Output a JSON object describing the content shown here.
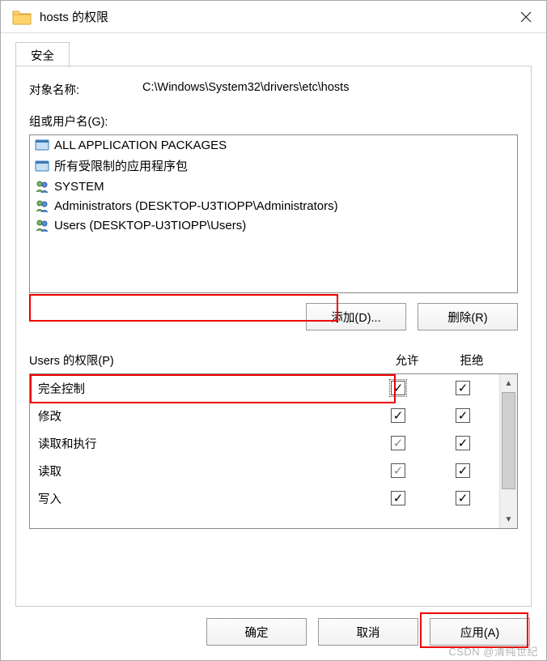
{
  "titlebar": {
    "title": "hosts 的权限"
  },
  "tabs": {
    "security": "安全"
  },
  "object": {
    "label": "对象名称:",
    "path": "C:\\Windows\\System32\\drivers\\etc\\hosts"
  },
  "groups_label": "组或用户名(G):",
  "groups": [
    {
      "icon": "pkg",
      "name": "ALL APPLICATION PACKAGES"
    },
    {
      "icon": "pkg",
      "name": "所有受限制的应用程序包"
    },
    {
      "icon": "users",
      "name": "SYSTEM"
    },
    {
      "icon": "users",
      "name": "Administrators (DESKTOP-U3TIOPP\\Administrators)"
    },
    {
      "icon": "users",
      "name": "Users (DESKTOP-U3TIOPP\\Users)",
      "selected": true
    }
  ],
  "buttons": {
    "add": "添加(D)...",
    "remove": "删除(R)",
    "ok": "确定",
    "cancel": "取消",
    "apply": "应用(A)"
  },
  "perm_header": {
    "title": "Users 的权限(P)",
    "allow": "允许",
    "deny": "拒绝"
  },
  "permissions": [
    {
      "name": "完全控制",
      "allow": "checked",
      "deny": "unchecked"
    },
    {
      "name": "修改",
      "allow": "checked",
      "deny": "unchecked"
    },
    {
      "name": "读取和执行",
      "allow": "grey-checked",
      "deny": "unchecked"
    },
    {
      "name": "读取",
      "allow": "grey-checked",
      "deny": "unchecked"
    },
    {
      "name": "写入",
      "allow": "checked",
      "deny": "unchecked"
    }
  ],
  "watermark": "CSDN @清纯世纪"
}
